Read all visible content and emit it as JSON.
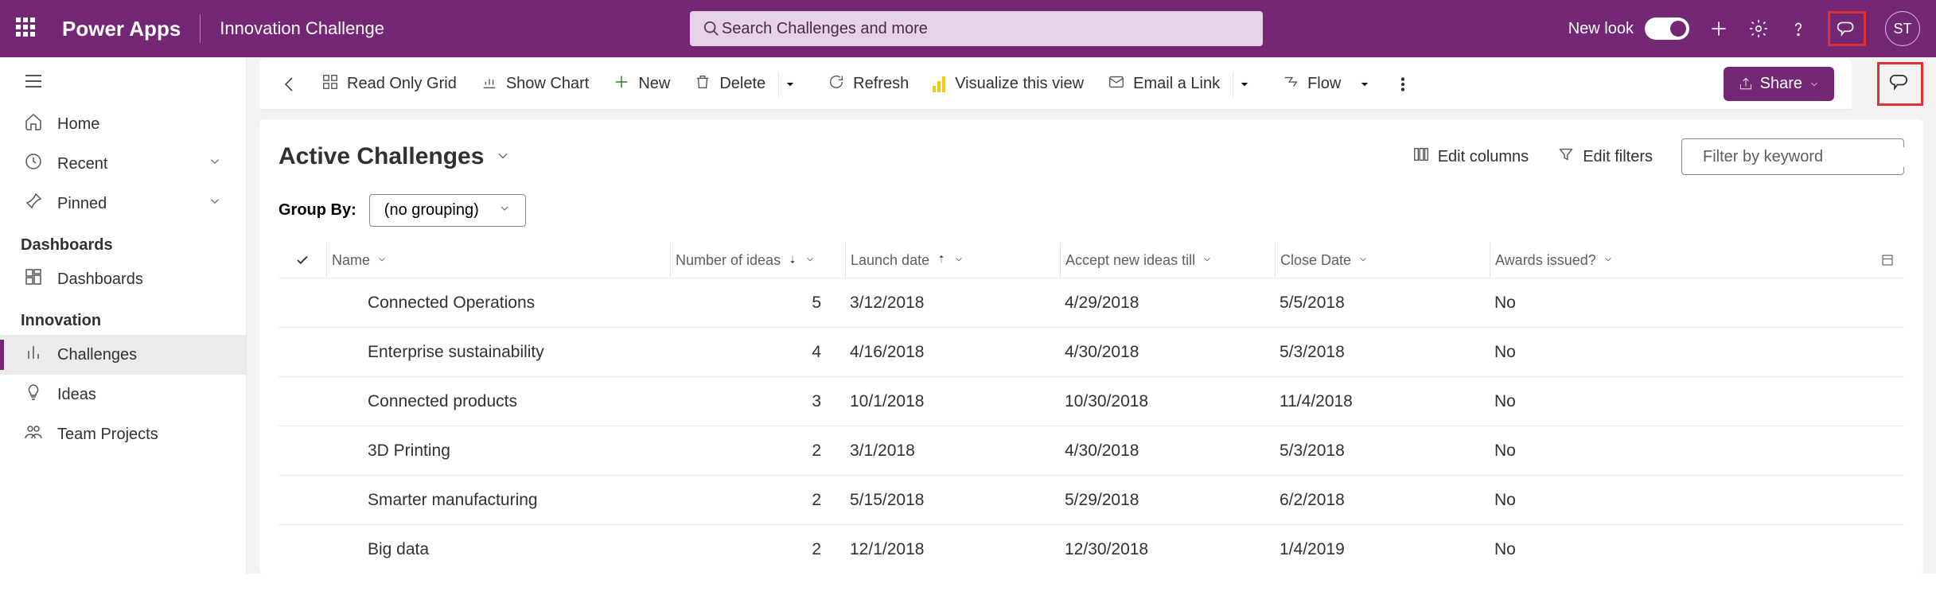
{
  "header": {
    "brand": "Power Apps",
    "environment": "Innovation Challenge",
    "search_placeholder": "Search Challenges and more",
    "new_look_label": "New look",
    "avatar_initials": "ST"
  },
  "sidebar": {
    "home": "Home",
    "recent": "Recent",
    "pinned": "Pinned",
    "group_dashboards_title": "Dashboards",
    "dashboards": "Dashboards",
    "group_innovation_title": "Innovation",
    "challenges": "Challenges",
    "ideas": "Ideas",
    "team_projects": "Team Projects"
  },
  "commands": {
    "read_only_grid": "Read Only Grid",
    "show_chart": "Show Chart",
    "new": "New",
    "delete": "Delete",
    "refresh": "Refresh",
    "visualize": "Visualize this view",
    "email_link": "Email a Link",
    "flow": "Flow",
    "share": "Share"
  },
  "view": {
    "title": "Active Challenges",
    "edit_columns": "Edit columns",
    "edit_filters": "Edit filters",
    "filter_placeholder": "Filter by keyword",
    "group_by_label": "Group By:",
    "group_by_value": "(no grouping)"
  },
  "table": {
    "columns": {
      "name": "Name",
      "num_ideas": "Number of ideas",
      "launch": "Launch date",
      "accept": "Accept new ideas till",
      "close": "Close Date",
      "awards": "Awards issued?"
    },
    "rows": [
      {
        "name": "Connected Operations",
        "num": "5",
        "launch": "3/12/2018",
        "accept": "4/29/2018",
        "close": "5/5/2018",
        "awards": "No"
      },
      {
        "name": "Enterprise sustainability",
        "num": "4",
        "launch": "4/16/2018",
        "accept": "4/30/2018",
        "close": "5/3/2018",
        "awards": "No"
      },
      {
        "name": "Connected products",
        "num": "3",
        "launch": "10/1/2018",
        "accept": "10/30/2018",
        "close": "11/4/2018",
        "awards": "No"
      },
      {
        "name": "3D Printing",
        "num": "2",
        "launch": "3/1/2018",
        "accept": "4/30/2018",
        "close": "5/3/2018",
        "awards": "No"
      },
      {
        "name": "Smarter manufacturing",
        "num": "2",
        "launch": "5/15/2018",
        "accept": "5/29/2018",
        "close": "6/2/2018",
        "awards": "No"
      },
      {
        "name": "Big data",
        "num": "2",
        "launch": "12/1/2018",
        "accept": "12/30/2018",
        "close": "1/4/2019",
        "awards": "No"
      }
    ]
  }
}
